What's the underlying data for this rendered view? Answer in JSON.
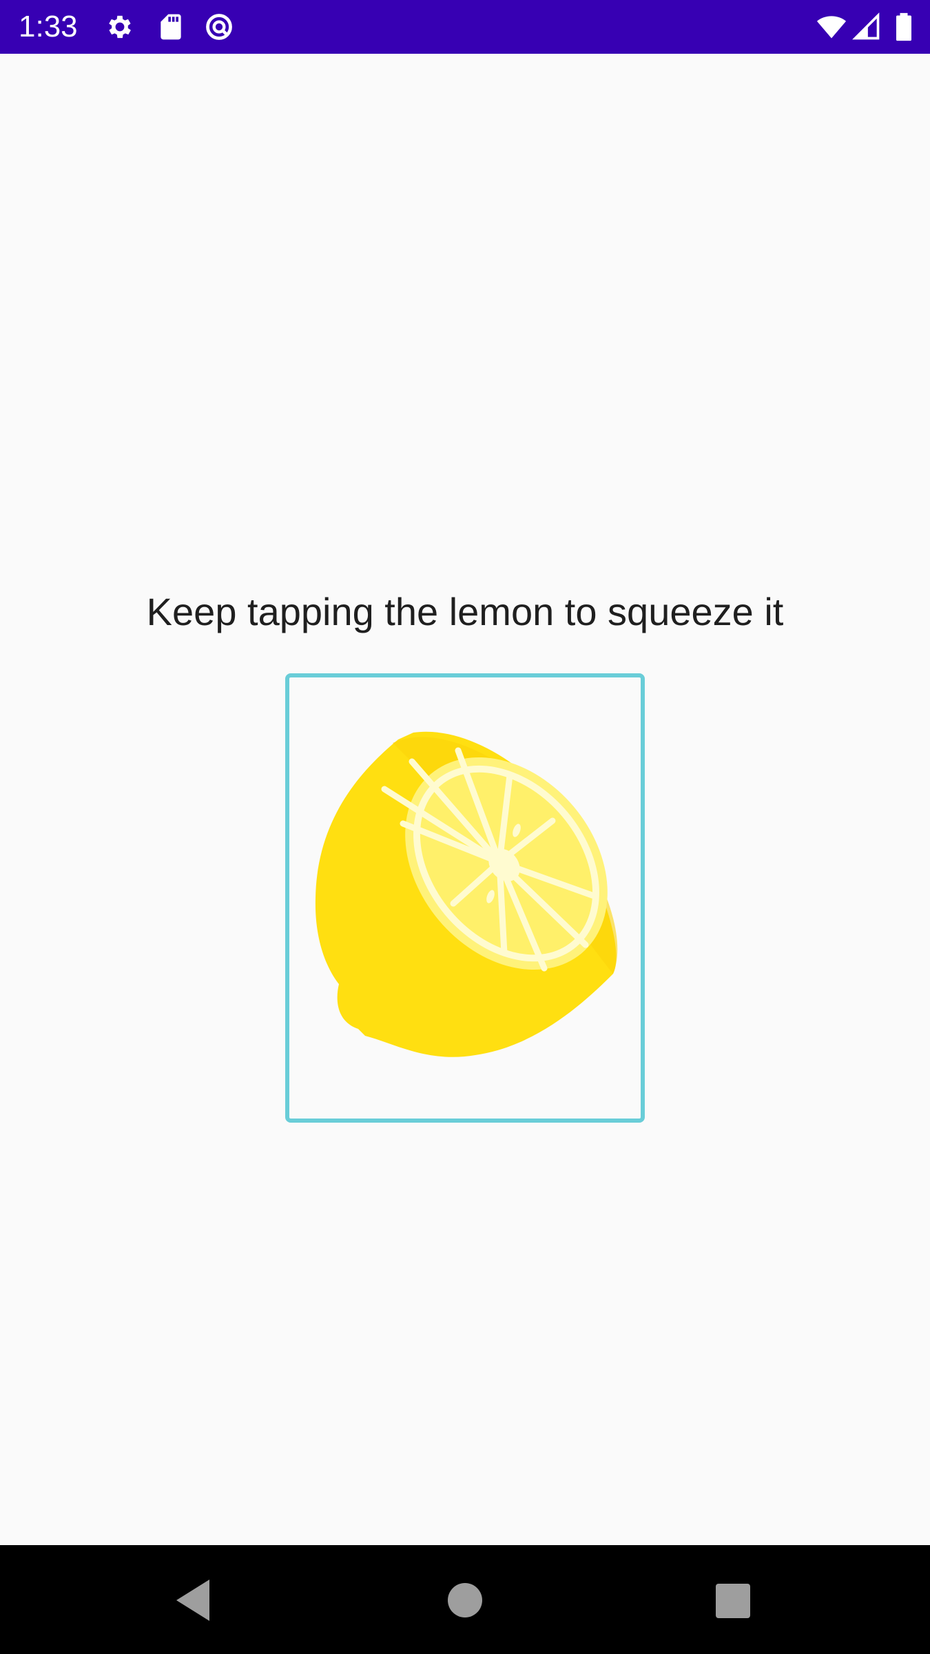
{
  "status_bar": {
    "time": "1:33",
    "background_color": "#3700b3",
    "left_icons": [
      "settings-gear-icon",
      "sd-card-icon",
      "circle-slash-icon"
    ],
    "right_icons": [
      "wifi-icon",
      "cellular-signal-icon",
      "battery-icon"
    ]
  },
  "main": {
    "instruction": "Keep tapping the lemon to squeeze it",
    "image": {
      "icon": "lemon-half-icon",
      "border_color": "#69cdd8"
    }
  },
  "nav_bar": {
    "buttons": [
      "back-icon",
      "home-icon",
      "recents-icon"
    ]
  }
}
